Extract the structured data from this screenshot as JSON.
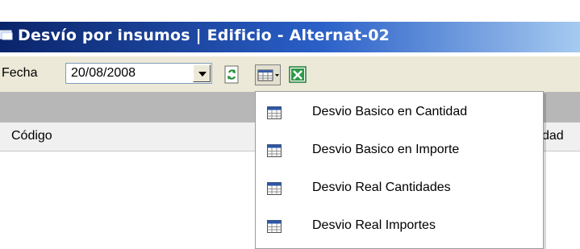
{
  "window": {
    "title": "Desvío por insumos | Edificio - Alternat-02"
  },
  "toolbar": {
    "fecha_label": "Fecha",
    "fecha_value": "20/08/2008"
  },
  "grid": {
    "columns": [
      "Código",
      "dad"
    ]
  },
  "menu": {
    "items": [
      {
        "label": "Desvio Basico en Cantidad",
        "icon": "grid-icon"
      },
      {
        "label": "Desvio Basico en Importe",
        "icon": "grid-icon"
      },
      {
        "label": "Desvio Real Cantidades",
        "icon": "grid-icon"
      },
      {
        "label": "Desvio Real Importes",
        "icon": "grid-icon"
      }
    ]
  },
  "colors": {
    "title_bar_start": "#0a246a",
    "title_bar_end": "#a6caf0",
    "toolbar_bg": "#ece9d8",
    "excel_green": "#1e7b35"
  }
}
